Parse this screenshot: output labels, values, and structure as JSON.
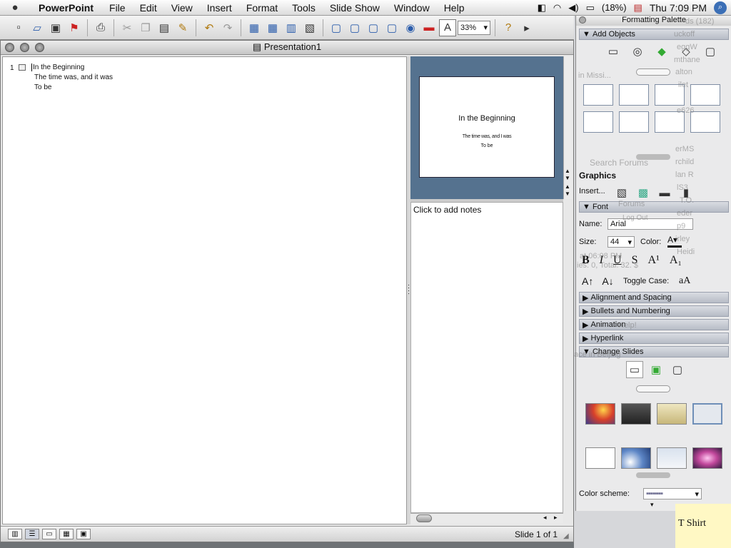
{
  "menubar": {
    "app_name": "PowerPoint",
    "menus": [
      "File",
      "Edit",
      "View",
      "Insert",
      "Format",
      "Tools",
      "Slide Show",
      "Window",
      "Help"
    ],
    "battery": "(18%)",
    "clock": "Thu 7:09 PM"
  },
  "toolbar": {
    "zoom": "33%"
  },
  "window": {
    "title": "Presentation1"
  },
  "outline": {
    "slide_number": "1",
    "lines": [
      "In the Beginning",
      "The time was, and it was",
      "To be"
    ]
  },
  "slide": {
    "title": "In the Beginning",
    "body_lines": [
      "The time was, and I was",
      "To be"
    ]
  },
  "notes": {
    "placeholder": "Click to add notes"
  },
  "status": {
    "slide_indicator": "Slide 1 of 1"
  },
  "palette": {
    "title": "Formatting Palette",
    "add_objects": "Add Objects",
    "graphics": "Graphics",
    "insert_label": "Insert...",
    "font_section": "Font",
    "name_label": "Name:",
    "font_name": "Arial",
    "size_label": "Size:",
    "font_size": "44",
    "color_label": "Color:",
    "toggle_case": "Toggle Case:",
    "toggle_case_sample": "aA",
    "sections": [
      "Alignment and Spacing",
      "Bullets and Numbering",
      "Animation",
      "Hyperlink"
    ],
    "change_slides": "Change Slides",
    "color_scheme_label": "Color scheme:"
  },
  "background": {
    "ghost_texts": [
      "uckoff",
      "eggW",
      "mthane",
      "in Missi...",
      "alton",
      "ilet",
      "e626",
      "erMS",
      "rchild",
      "lan R",
      "lS3",
      "T.O.",
      "eder",
      "p9",
      "irley",
      "Heidi",
      "Search Forums",
      "Forums",
      "Log Out",
      "at 06:08 PM",
      "ies: 0, Total: 32. $",
      "Help!",
      "ace in Beijing"
    ],
    "counter": "ds (182)",
    "tshirt": "T Shirt"
  },
  "colors": {
    "slide_pane_bg": "#55728f",
    "accent": "#3b6fb6"
  }
}
